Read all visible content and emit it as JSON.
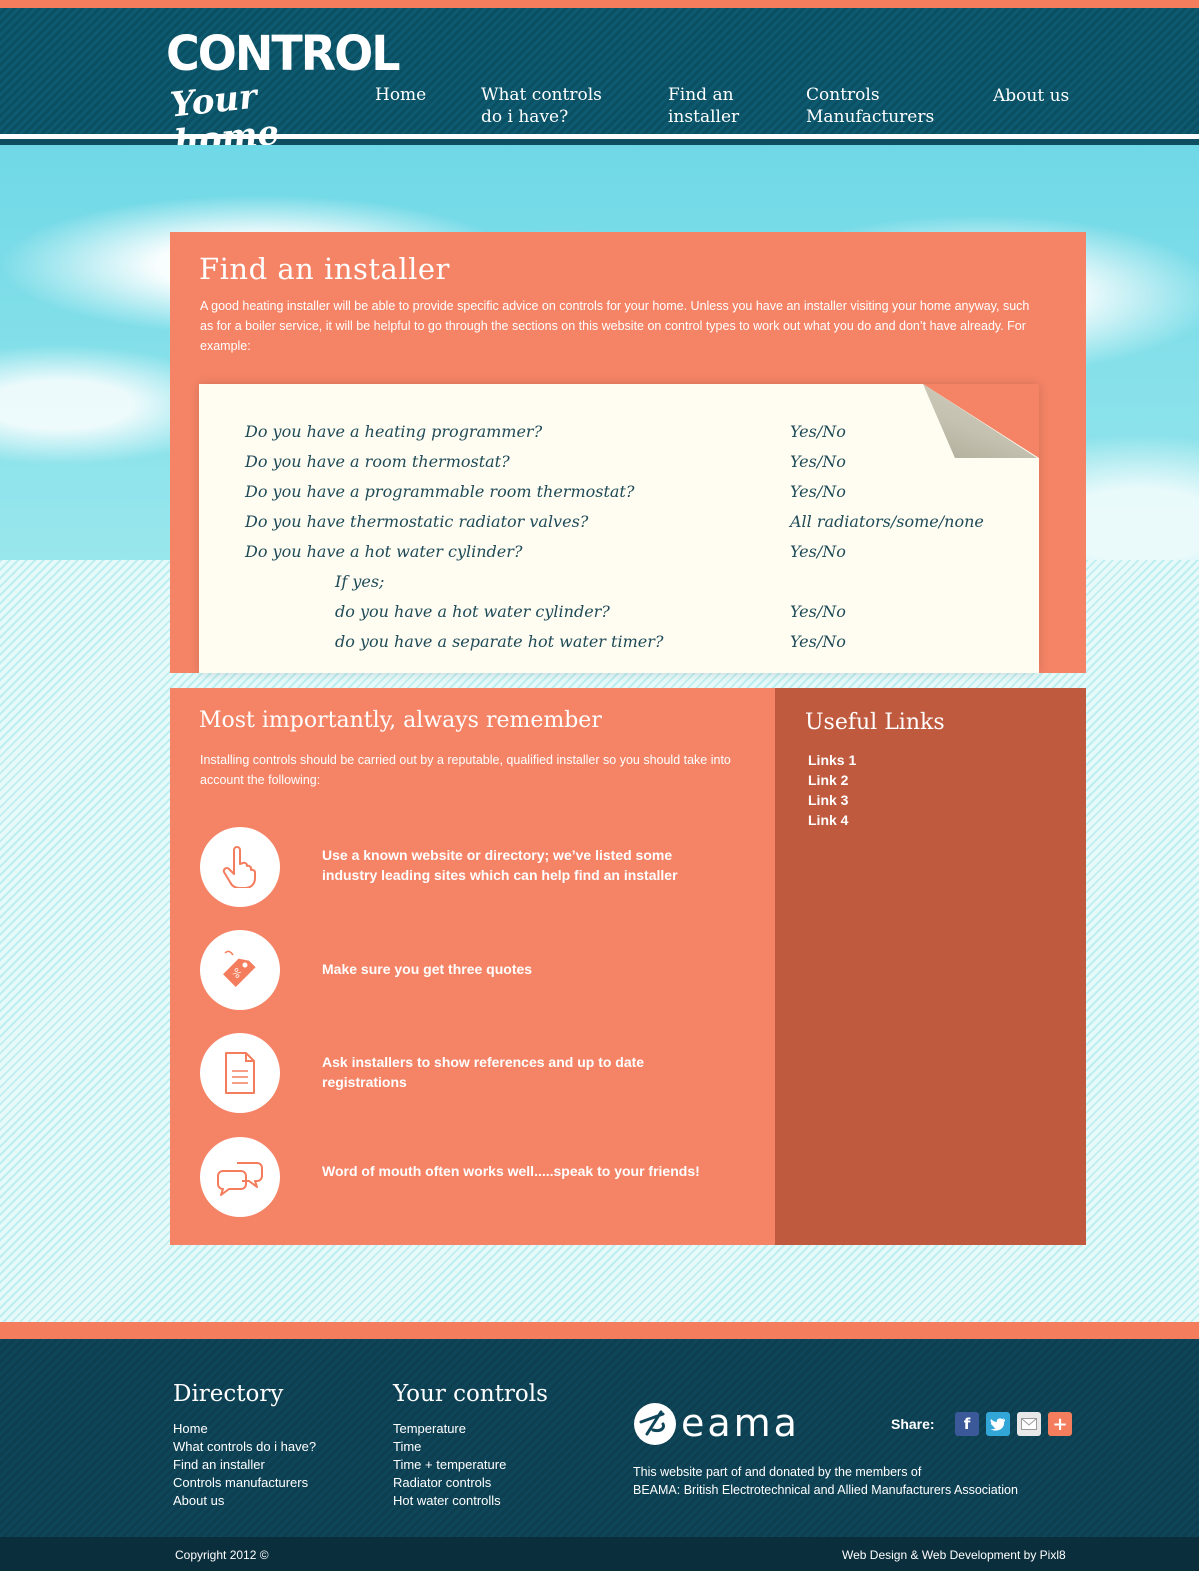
{
  "brand": {
    "line1": "CONTROL",
    "line2": "Your home"
  },
  "nav": {
    "home": "Home",
    "what_controls_1": "What controls",
    "what_controls_2": "do i have?",
    "find_1": "Find an",
    "find_2": "installer",
    "manufacturers_1": "Controls",
    "manufacturers_2": "Manufacturers",
    "about": "About us"
  },
  "find": {
    "title": "Find an installer",
    "intro": "A good heating installer will be able to provide specific advice on controls for your home. Unless you have an installer visiting your home anyway, such as for a boiler service, it will be helpful to go through the  sections on this website on control types to work out what you do and don’t have already. For example:",
    "questions": [
      {
        "q": "Do you have a heating programmer?",
        "a": "Yes/No"
      },
      {
        "q": "Do you have a room thermostat?",
        "a": "Yes/No"
      },
      {
        "q": "Do you have a programmable room thermostat?",
        "a": "Yes/No"
      },
      {
        "q": "Do you have thermostatic radiator valves?",
        "a": "All radiators/some/none"
      },
      {
        "q": "Do you have a hot water cylinder?",
        "a": "Yes/No"
      },
      {
        "q": "If yes;",
        "a": ""
      },
      {
        "q": "do you have a hot water cylinder?",
        "a": "Yes/No"
      },
      {
        "q": "do you have a separate hot water timer?",
        "a": "Yes/No"
      }
    ]
  },
  "remember": {
    "title": "Most importantly, always remember",
    "intro": "Installing controls should be carried out by a reputable, qualified installer so you should take into account the following:",
    "tips": [
      {
        "icon": "hand-pointer-icon",
        "text": "Use a known website or directory; we’ve listed some industry leading sites which can help find an installer"
      },
      {
        "icon": "price-tag-icon",
        "text": "Make sure you get three quotes"
      },
      {
        "icon": "document-icon",
        "text": "Ask installers to show references and up to date registrations"
      },
      {
        "icon": "speech-bubbles-icon",
        "text": "Word of mouth often works well.....speak to your friends!"
      }
    ]
  },
  "useful_links": {
    "title": "Useful Links",
    "links": [
      "Links 1",
      "Link 2",
      "Link 3",
      "Link 4"
    ]
  },
  "footer": {
    "directory_title": "Directory",
    "directory": [
      "Home",
      "What controls do i have?",
      "Find an installer",
      "Controls manufacturers",
      "About us"
    ],
    "controls_title": "Your controls",
    "controls": [
      "Temperature",
      "Time",
      "Time + temperature",
      "Radiator controls",
      "Hot water controlls"
    ],
    "beama_logo_text": "eama",
    "beama_line1": "This website part of and donated by the members of",
    "beama_line2": "BEAMA: British Electrotechnical and Allied Manufacturers Association",
    "share_label": "Share:",
    "share_icons": [
      "facebook-icon",
      "twitter-icon",
      "email-icon",
      "plus-icon"
    ],
    "copyright": "Copyright 2012 ©",
    "credit": "Web Design & Web Development by  Pixl8"
  },
  "colors": {
    "accent": "#f47d5d",
    "panel": "#f58466",
    "panel_dark": "#c05a3e",
    "header": "#0e5a70",
    "footer": "#0f4558",
    "note": "#fffdf1",
    "handwriting": "#1f4a58"
  }
}
